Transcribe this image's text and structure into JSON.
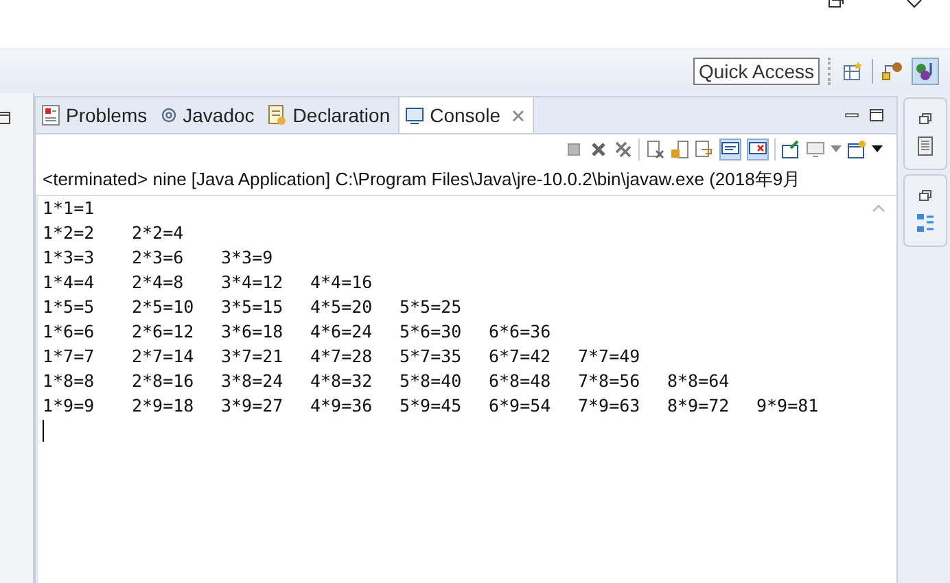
{
  "toolbar": {
    "quick_access": "Quick Access"
  },
  "tabs": [
    {
      "label": "Problems",
      "kind": "problems",
      "selected": false,
      "closable": false
    },
    {
      "label": "Javadoc",
      "kind": "javadoc",
      "selected": false,
      "closable": false
    },
    {
      "label": "Declaration",
      "kind": "declaration",
      "selected": false,
      "closable": false
    },
    {
      "label": "Console",
      "kind": "console",
      "selected": true,
      "closable": true
    }
  ],
  "console": {
    "header": "<terminated> nine [Java Application] C:\\Program Files\\Java\\jre-10.0.2\\bin\\javaw.exe (2018年9月",
    "lines": [
      [
        "1*1=1"
      ],
      [
        "1*2=2",
        "2*2=4"
      ],
      [
        "1*3=3",
        "2*3=6",
        "3*3=9"
      ],
      [
        "1*4=4",
        "2*4=8",
        "3*4=12",
        "4*4=16"
      ],
      [
        "1*5=5",
        "2*5=10",
        "3*5=15",
        "4*5=20",
        "5*5=25"
      ],
      [
        "1*6=6",
        "2*6=12",
        "3*6=18",
        "4*6=24",
        "5*6=30",
        "6*6=36"
      ],
      [
        "1*7=7",
        "2*7=14",
        "3*7=21",
        "4*7=28",
        "5*7=35",
        "6*7=42",
        "7*7=49"
      ],
      [
        "1*8=8",
        "2*8=16",
        "3*8=24",
        "4*8=32",
        "5*8=40",
        "6*8=48",
        "7*8=56",
        "8*8=64"
      ],
      [
        "1*9=9",
        "2*9=18",
        "3*9=27",
        "4*9=36",
        "5*9=45",
        "6*9=54",
        "7*9=63",
        "8*9=72",
        "9*9=81"
      ]
    ]
  }
}
